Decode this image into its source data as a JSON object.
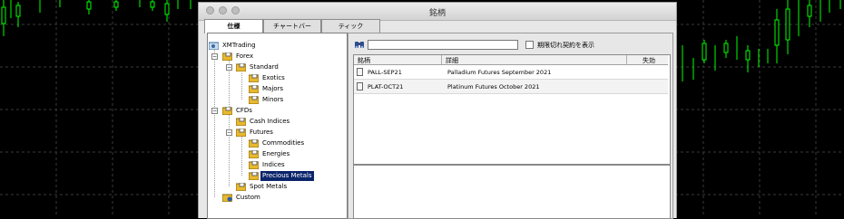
{
  "window": {
    "title": "銘柄"
  },
  "tabs": [
    {
      "label": "仕様",
      "active": true
    },
    {
      "label": "チャートバー",
      "active": false
    },
    {
      "label": "ティック",
      "active": false
    }
  ],
  "tree": {
    "root": "XMTrading",
    "forex": "Forex",
    "standard": "Standard",
    "exotics": "Exotics",
    "majors": "Majors",
    "minors": "Minors",
    "cfds": "CFDs",
    "cash_indices": "Cash Indices",
    "futures": "Futures",
    "commodities": "Commodities",
    "energies": "Energies",
    "indices": "Indices",
    "precious_metals": "Precious Metals",
    "spot_metals": "Spot Metals",
    "custom": "Custom"
  },
  "search": {
    "value": "",
    "checkbox_label": "期限切れ契約を表示",
    "checked": false
  },
  "table": {
    "headers": {
      "symbol": "銘柄",
      "description": "詳細",
      "expired": "失効"
    },
    "rows": [
      {
        "symbol": "PALL-SEP21",
        "description": "Palladium Futures September 2021",
        "expired": ""
      },
      {
        "symbol": "PLAT-OCT21",
        "description": "Platinum Futures October 2021",
        "expired": ""
      }
    ]
  },
  "colors": {
    "candle_up": "#00ff00",
    "window_bg": "#e7e7e7",
    "selection": "#0a246a",
    "folder": "#e8b82e"
  }
}
